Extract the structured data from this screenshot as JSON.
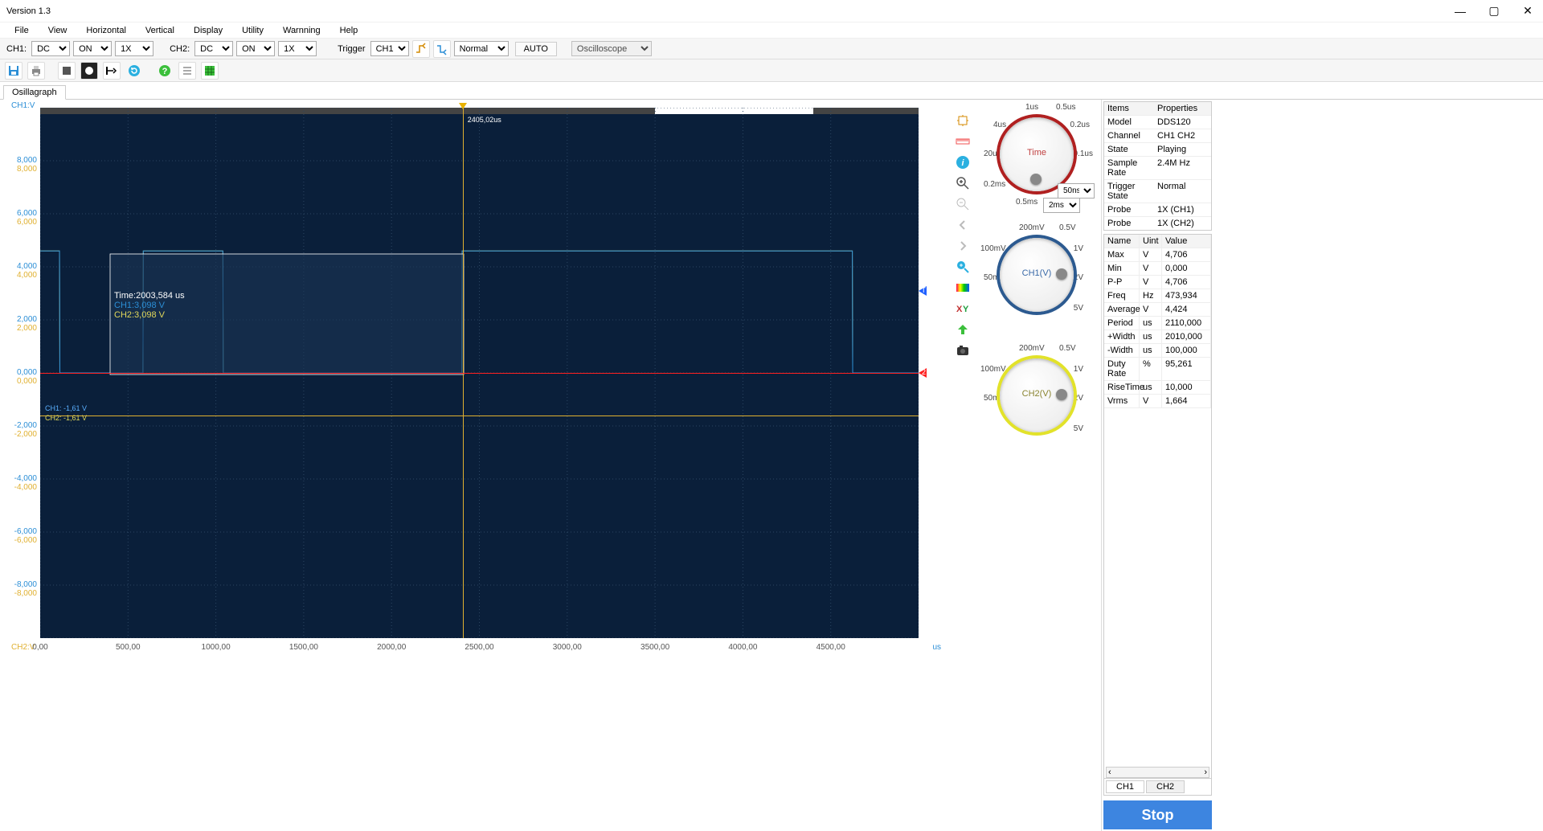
{
  "title": "Version 1.3",
  "menu": [
    "File",
    "View",
    "Horizontal",
    "Vertical",
    "Display",
    "Utility",
    "Warnning",
    "Help"
  ],
  "toolbar": {
    "ch1": {
      "label": "CH1:",
      "coupling": "DC",
      "enable": "ON",
      "probe": "1X"
    },
    "ch2": {
      "label": "CH2:",
      "coupling": "DC",
      "enable": "ON",
      "probe": "1X"
    },
    "trigger_label": "Trigger",
    "trigger_src": "CH1",
    "trigger_mode": "Normal",
    "auto": "AUTO",
    "device": "Oscilloscope"
  },
  "tab": "Osillagraph",
  "axis": {
    "ch1_label": "CH1:V",
    "ch2_label": "CH2:V",
    "x_unit": "us",
    "yticks": [
      "8,000",
      "6,000",
      "4,000",
      "2,000",
      "0,000",
      "-2,000",
      "-4,000",
      "-6,000",
      "-8,000"
    ],
    "xticks": [
      "0,00",
      "500,00",
      "1000,00",
      "1500,00",
      "2000,00",
      "2500,00",
      "3000,00",
      "3500,00",
      "4000,00",
      "4500,00"
    ]
  },
  "cursor": {
    "x_us": 2405.02,
    "x_label": "2405,02us"
  },
  "cursors": {
    "ch1": "CH1: -1,61 V",
    "ch2": "CH2: -1,61 V"
  },
  "tooltip": {
    "time": "Time:2003,584 us",
    "ch1": "CH1:3,098 V",
    "ch2": "CH2:3,098 V"
  },
  "dials": {
    "time": {
      "caption": "Time",
      "caption_color": "#c04040",
      "ticks": [
        "1us",
        "0.5us",
        "4us",
        "0.2us",
        "20us",
        "0.1us",
        "0.2ms",
        "0.5ms"
      ],
      "sel1": "50ns",
      "sel2": "2ms",
      "ring": "#b02020"
    },
    "ch1": {
      "caption": "CH1(V)",
      "caption_color": "#3a6aa8",
      "ticks": [
        "200mV",
        "0.5V",
        "100mV",
        "1V",
        "50mV",
        "2V",
        "5V"
      ],
      "ring": "#2c5a90"
    },
    "ch2": {
      "caption": "CH2(V)",
      "caption_color": "#8a8430",
      "ticks": [
        "200mV",
        "0.5V",
        "100mV",
        "1V",
        "50mV",
        "2V",
        "5V"
      ],
      "ring": "#e2e22a"
    }
  },
  "props": {
    "header": [
      "Items",
      "Properties"
    ],
    "rows": [
      [
        "Model",
        "DDS120"
      ],
      [
        "Channel",
        "CH1 CH2"
      ],
      [
        "State",
        "Playing"
      ],
      [
        "Sample Rate",
        "2.4M Hz"
      ],
      [
        "Trigger State",
        "Normal"
      ],
      [
        "Probe",
        "1X (CH1)"
      ],
      [
        "Probe",
        "1X (CH2)"
      ]
    ]
  },
  "meas": {
    "header": [
      "Name",
      "Uint",
      "Value"
    ],
    "rows": [
      [
        "Max",
        "V",
        "4,706"
      ],
      [
        "Min",
        "V",
        "0,000"
      ],
      [
        "P-P",
        "V",
        "4,706"
      ],
      [
        "Freq",
        "Hz",
        "473,934"
      ],
      [
        "Average",
        "V",
        "4,424"
      ],
      [
        "Period",
        "us",
        "2110,000"
      ],
      [
        "+Width",
        "us",
        "2010,000"
      ],
      [
        "-Width",
        "us",
        "100,000"
      ],
      [
        "Duty Rate",
        "%",
        "95,261"
      ],
      [
        "RiseTime",
        "us",
        "10,000"
      ],
      [
        "Vrms",
        "V",
        "1,664"
      ]
    ],
    "tabs": [
      "CH1",
      "CH2"
    ]
  },
  "stop": "Stop",
  "chart_data": {
    "type": "line",
    "xlabel": "us",
    "ylabel": "V",
    "xlim": [
      0,
      5000
    ],
    "ylim": [
      -10,
      10
    ],
    "series": [
      {
        "name": "CH1",
        "color": "#2b8ed6",
        "x": [
          0,
          110,
          112,
          585,
          587,
          1040,
          1042,
          2400,
          2402,
          4623,
          4625,
          5000
        ],
        "y": [
          4.6,
          4.6,
          0.0,
          0.0,
          4.6,
          4.6,
          0.0,
          0.0,
          4.6,
          4.6,
          0.0,
          0.0
        ]
      },
      {
        "name": "CH2",
        "color": "#e2d85a",
        "x": [
          0,
          110,
          112,
          585,
          587,
          1040,
          1042,
          2400,
          2402,
          4623,
          4625,
          5000
        ],
        "y": [
          4.6,
          4.6,
          0.0,
          0.0,
          4.6,
          4.6,
          0.0,
          0.0,
          4.6,
          4.6,
          0.0,
          0.0
        ]
      }
    ],
    "cursor_x_us": 2405.02,
    "trigger_level_v": 0.0,
    "horiz_marker_v": -1.61
  }
}
